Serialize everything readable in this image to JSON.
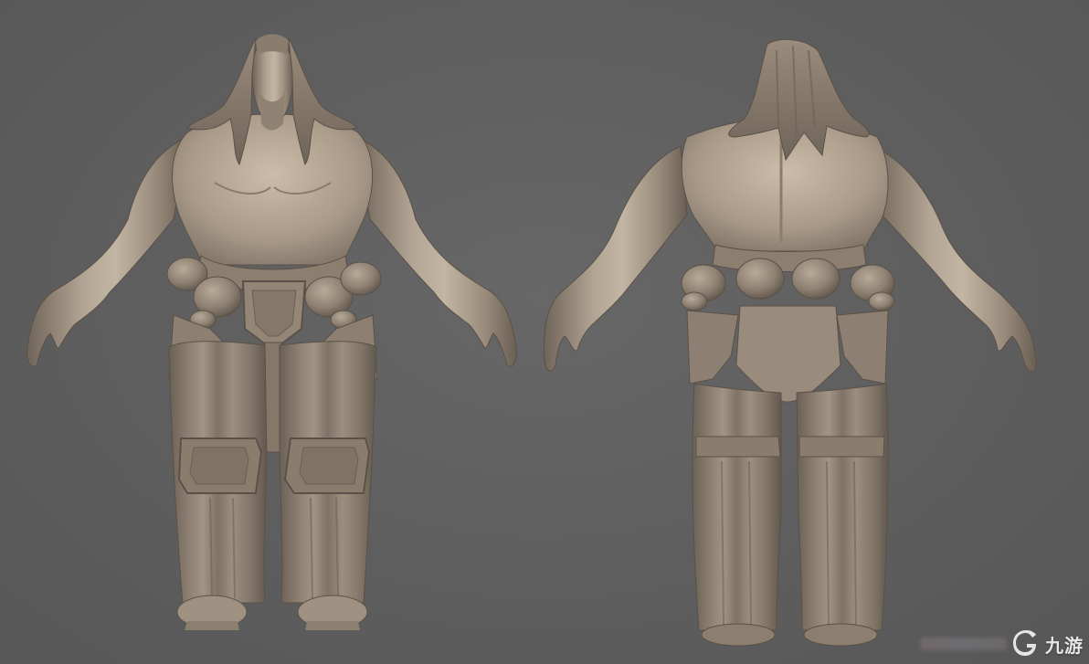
{
  "scene": {
    "background_color": "#5f5f5f",
    "clay_color": "#a89a8a",
    "views": [
      {
        "id": "front",
        "label": ""
      },
      {
        "id": "back",
        "label": ""
      }
    ]
  },
  "watermark": {
    "brand_text": "九游",
    "logo_icon": "jiuyou-logo-icon",
    "color": "#ffffff"
  }
}
